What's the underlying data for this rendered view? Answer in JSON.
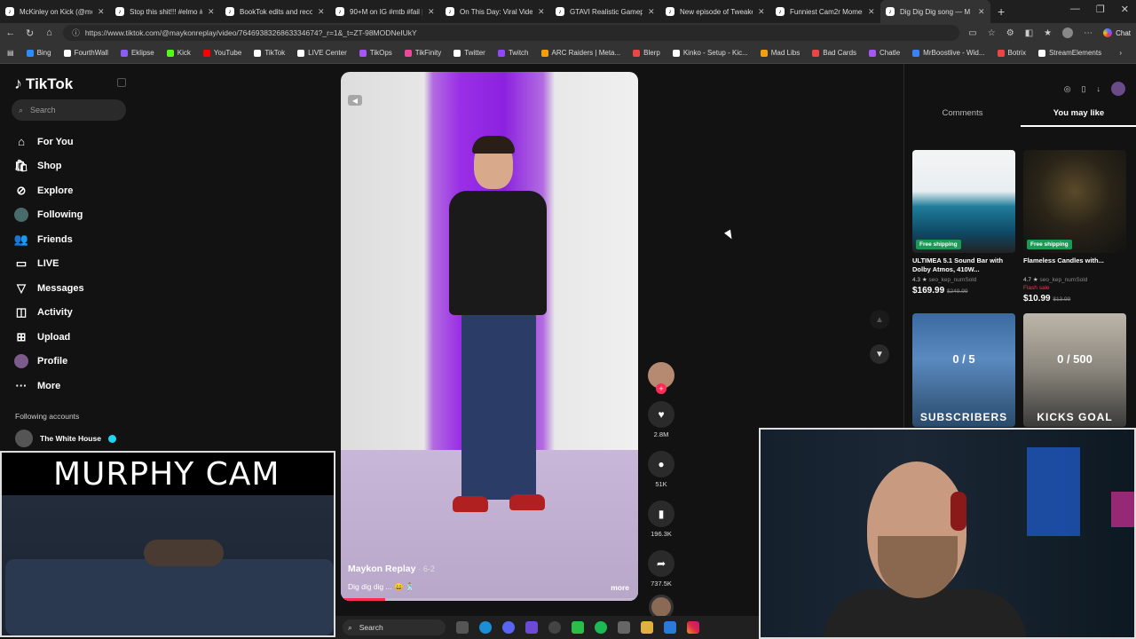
{
  "browser": {
    "tabs": [
      {
        "label": "McKinley on Kick (@mckin",
        "active": false
      },
      {
        "label": "Stop this shit!!! #elmo #fyp",
        "active": false
      },
      {
        "label": "BookTok edits and recomm",
        "active": false
      },
      {
        "label": "90+M on IG #mtb #fail | m",
        "active": false
      },
      {
        "label": "On This Day: Viral Video Ac",
        "active": false
      },
      {
        "label": "GTAVI Realistic Gameplay",
        "active": false
      },
      {
        "label": "New episode of Tweaker S",
        "active": false
      },
      {
        "label": "Funniest Cam2r Moments",
        "active": false
      },
      {
        "label": "Dig Dig Dig song — M",
        "active": true
      }
    ],
    "new_tab": "+",
    "url": "https://www.tiktok.com/@maykonreplay/video/7646938326863334674?_r=1&_t=ZT-98MODNeIUkY",
    "chat_label": "Chat",
    "bookmarks": [
      {
        "label": "Bing",
        "color": "#2b8cff"
      },
      {
        "label": "FourthWall",
        "color": "#ffffff"
      },
      {
        "label": "Eklipse",
        "color": "#8b5cf6"
      },
      {
        "label": "Kick",
        "color": "#53fc18"
      },
      {
        "label": "YouTube",
        "color": "#ff0000"
      },
      {
        "label": "TikTok",
        "color": "#ffffff"
      },
      {
        "label": "LIVE Center",
        "color": "#ffffff"
      },
      {
        "label": "TikOps",
        "color": "#a855f7"
      },
      {
        "label": "TikFinity",
        "color": "#ec4899"
      },
      {
        "label": "Twitter",
        "color": "#ffffff"
      },
      {
        "label": "Twitch",
        "color": "#9146ff"
      },
      {
        "label": "ARC Raiders | Meta...",
        "color": "#f59e0b"
      },
      {
        "label": "Blerp",
        "color": "#ef4444"
      },
      {
        "label": "Kinko - Setup - Kic...",
        "color": "#ffffff"
      },
      {
        "label": "Mad Libs",
        "color": "#f59e0b"
      },
      {
        "label": "Bad Cards",
        "color": "#ef4444"
      },
      {
        "label": "Chatle",
        "color": "#a855f7"
      },
      {
        "label": "MrBoostlive - Wid...",
        "color": "#3b82f6"
      },
      {
        "label": "Botrix",
        "color": "#ef4444"
      },
      {
        "label": "StreamElements",
        "color": "#ffffff"
      }
    ]
  },
  "tiktok": {
    "logo": "TikTok",
    "search_placeholder": "Search",
    "nav": [
      {
        "label": "For You",
        "icon": "home-icon",
        "glyph": "⌂"
      },
      {
        "label": "Shop",
        "icon": "shop-bag-icon",
        "glyph": "🛍"
      },
      {
        "label": "Explore",
        "icon": "compass-icon",
        "glyph": "⊘"
      },
      {
        "label": "Following",
        "icon": "following-avatar-icon",
        "glyph": ""
      },
      {
        "label": "Friends",
        "icon": "friends-icon",
        "glyph": "👥"
      },
      {
        "label": "LIVE",
        "icon": "live-icon",
        "glyph": "▭"
      },
      {
        "label": "Messages",
        "icon": "messages-icon",
        "glyph": "▽"
      },
      {
        "label": "Activity",
        "icon": "activity-icon",
        "glyph": "◫"
      },
      {
        "label": "Upload",
        "icon": "upload-icon",
        "glyph": "⊞"
      },
      {
        "label": "Profile",
        "icon": "profile-avatar-icon",
        "glyph": ""
      },
      {
        "label": "More",
        "icon": "more-icon",
        "glyph": "···"
      }
    ],
    "following_header": "Following accounts",
    "following_accounts": [
      {
        "name": "The White House",
        "handle": "whitehouse"
      }
    ],
    "video": {
      "author": "Maykon Replay",
      "date": "6-2",
      "caption": "Dig dig dig ... 😄 🕺",
      "more": "more",
      "progress": 0.15
    },
    "actions": {
      "likes": "2.8M",
      "comments": "51K",
      "saves": "196.3K",
      "shares": "737.5K"
    },
    "right_panel": {
      "tabs": [
        {
          "label": "Comments",
          "active": false
        },
        {
          "label": "You may like",
          "active": true
        }
      ],
      "products": [
        {
          "title": "ULTIMEA 5.1 Sound Bar with Dolby Atmos, 410W...",
          "badge": "Free shipping",
          "rating": "4.3 ★",
          "sold": "seo_kep_numSold",
          "flash": "",
          "price": "$169.99",
          "old_price": "$249.99"
        },
        {
          "title": "Flameless Candles with...",
          "badge": "Free shipping",
          "rating": "4.7 ★",
          "sold": "seo_kep_numSold",
          "flash": "Flash sale",
          "price": "$10.99",
          "old_price": "$13.99"
        }
      ],
      "videos": [
        {
          "overlay": "0 / 5",
          "caption": "SUBSCRIBERS"
        },
        {
          "overlay": "0 / 500",
          "caption": "KICKS GOAL"
        }
      ]
    }
  },
  "overlays": {
    "murphy_cam_title": "MURPHY CAM"
  },
  "taskbar": {
    "search": "Search"
  }
}
